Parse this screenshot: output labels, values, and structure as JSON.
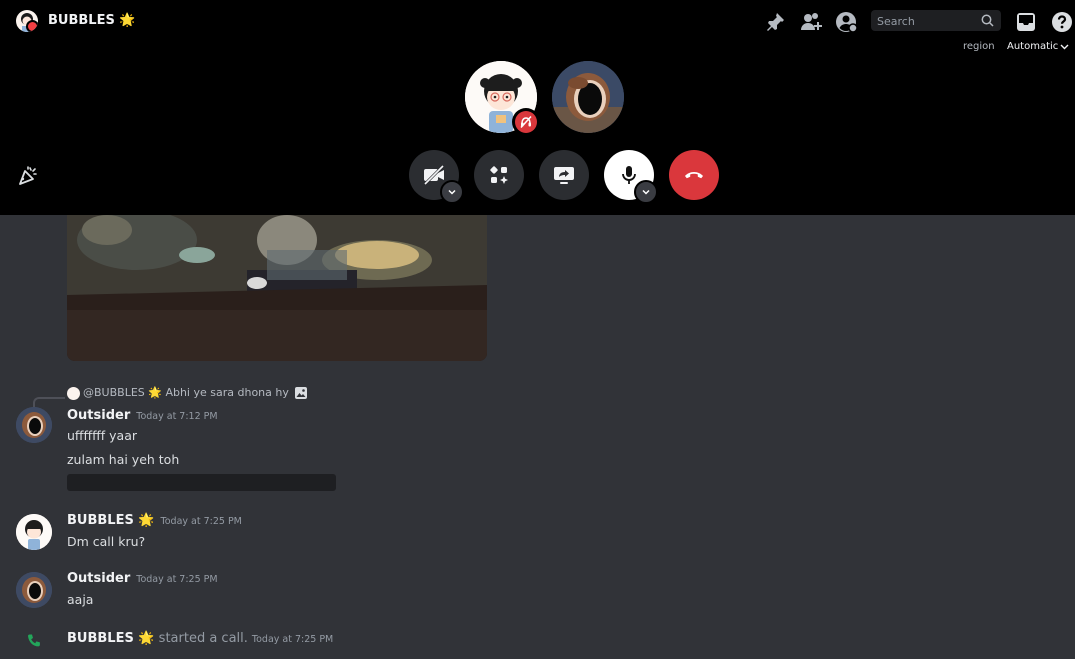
{
  "topbar": {
    "title": "BUBBLES 🌟",
    "search_placeholder": "Search",
    "icons": [
      "pin-icon",
      "add-friend-icon",
      "user-profile-icon",
      "search-icon",
      "inbox-icon",
      "help-icon"
    ]
  },
  "call": {
    "region_label": "region",
    "region_value": "Automatic",
    "participants": [
      "BUBBLES 🌟",
      "Outsider"
    ],
    "controls": [
      "camera-off-button",
      "activities-button",
      "screen-share-button",
      "microphone-button",
      "disconnect-button"
    ]
  },
  "messages": {
    "reply_ref": {
      "mention": "@BUBBLES 🌟",
      "text": "Abhi ye sara dhona hy"
    },
    "group1": {
      "author": "Outsider",
      "timestamp": "Today at 7:12 PM",
      "lines": [
        "ufffffff yaar",
        "zulam hai yeh toh"
      ]
    },
    "group2": {
      "author": "BUBBLES 🌟",
      "timestamp": "Today at 7:25 PM",
      "text": "Dm call kru?"
    },
    "group3": {
      "author": "Outsider",
      "timestamp": "Today at 7:25 PM",
      "text": "aaja"
    },
    "system": {
      "author": "BUBBLES 🌟",
      "action": "started a call.",
      "timestamp": "Today at 7:25 PM"
    }
  },
  "colors": {
    "call_bg": "#000000",
    "chat_bg": "#313338",
    "danger": "#da373c",
    "call_green": "#23a55a"
  }
}
